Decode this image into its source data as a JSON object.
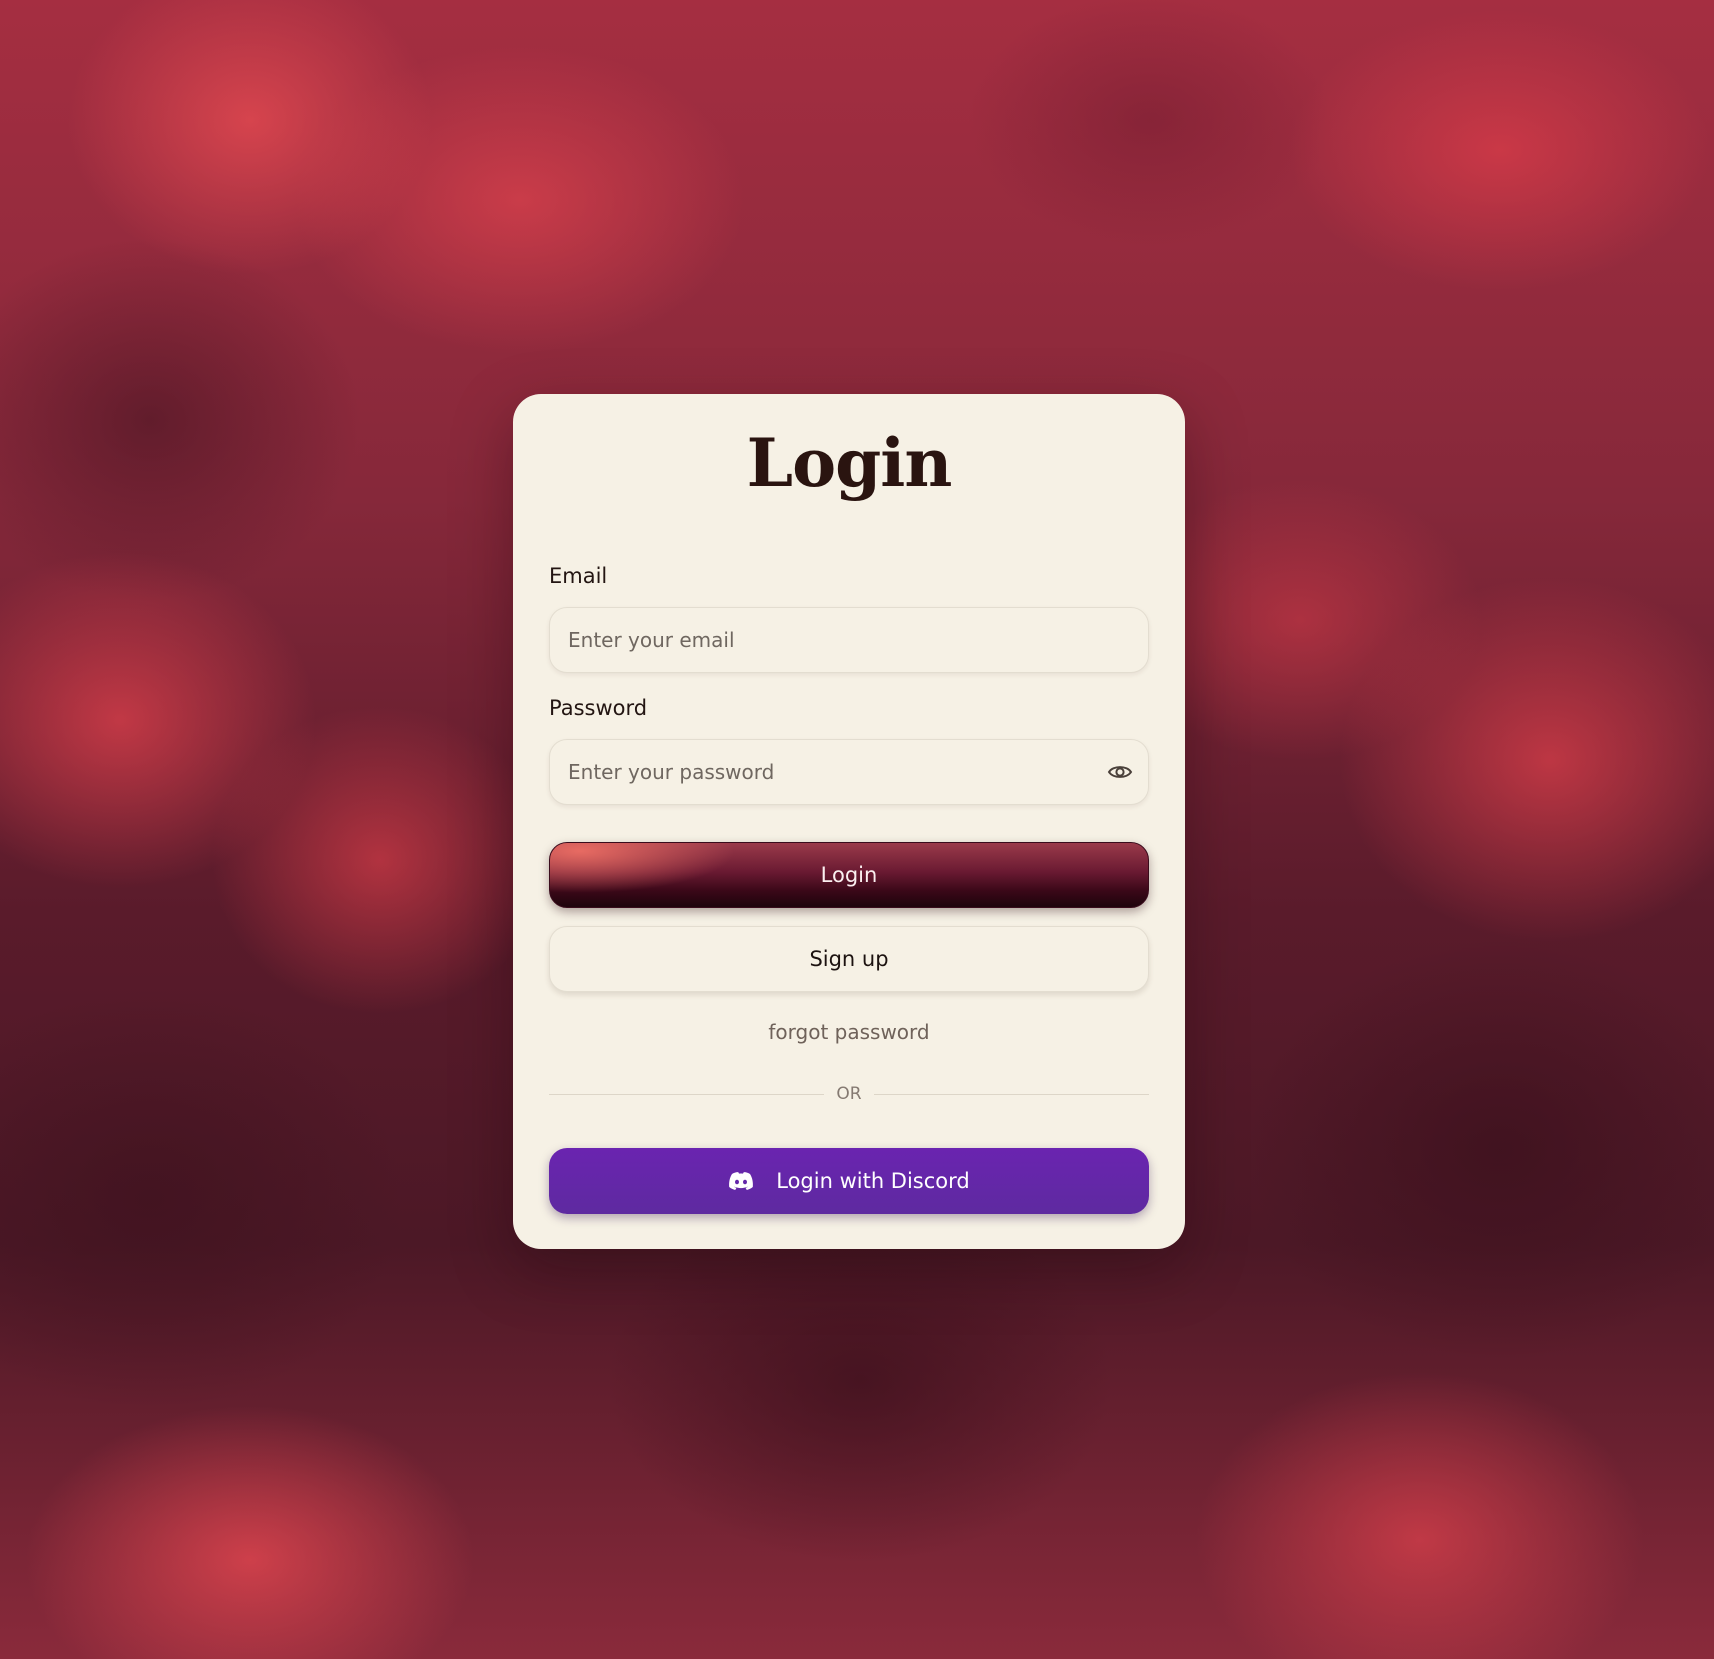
{
  "page": {
    "title": "Login"
  },
  "form": {
    "email": {
      "label": "Email",
      "placeholder": "Enter your email",
      "value": ""
    },
    "password": {
      "label": "Password",
      "placeholder": "Enter your password",
      "value": "",
      "toggle_icon": "eye-icon"
    }
  },
  "actions": {
    "login_label": "Login",
    "signup_label": "Sign up",
    "forgot_label": "forgot password",
    "divider_label": "OR",
    "discord_label": "Login with Discord",
    "discord_icon": "discord-icon"
  },
  "colors": {
    "card_background": "#f6f1e5",
    "login_button_dark": "#1e040c",
    "login_button_highlight": "#ec6e64",
    "discord_button": "#6a24b0",
    "title_text": "#2a1410",
    "background_red": "#a52e41",
    "background_dark": "#4c1826"
  }
}
